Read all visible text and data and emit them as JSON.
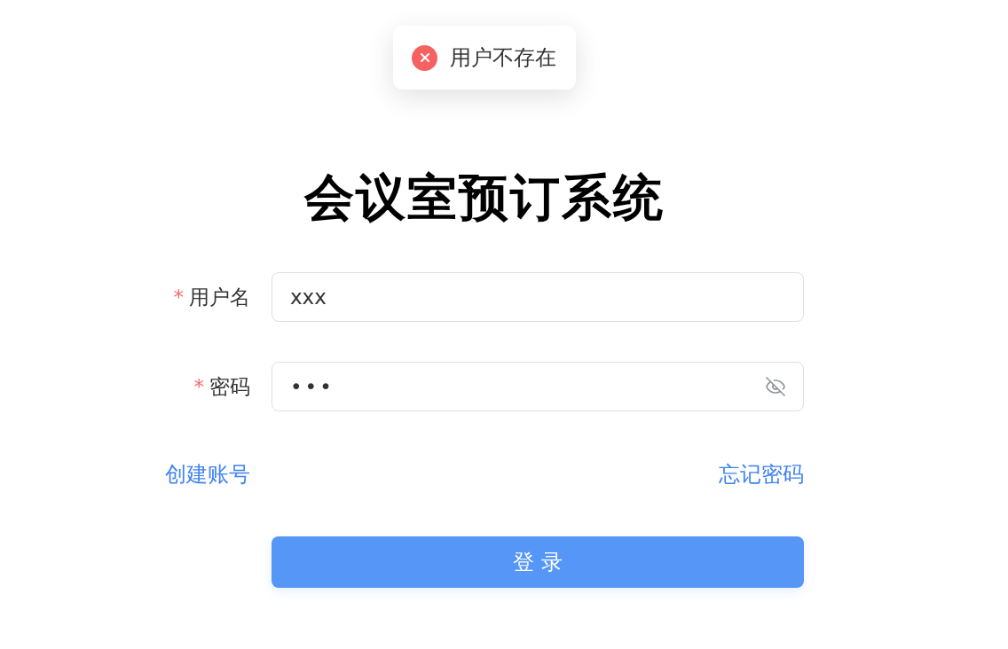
{
  "toast": {
    "kind": "error",
    "message": "用户不存在"
  },
  "title": "会议室预订系统",
  "fields": [
    {
      "label": "用户名",
      "required_mark": "*",
      "value": "xxx",
      "kind": "text"
    },
    {
      "label": "密码",
      "required_mark": "*",
      "value": "•••",
      "kind": "password"
    }
  ],
  "links": [
    "创建账号",
    "忘记密码"
  ],
  "submit": "登 录"
}
